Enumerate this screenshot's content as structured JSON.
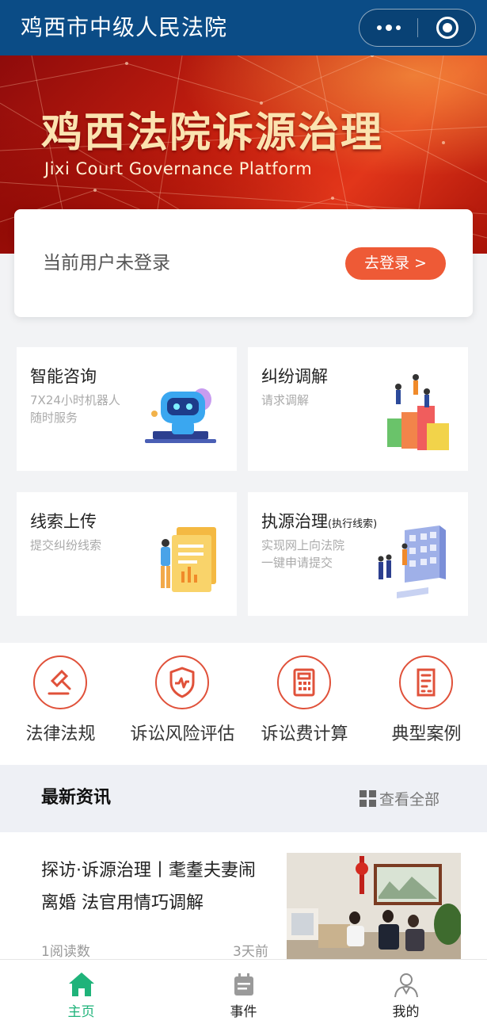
{
  "titlebar": {
    "title": "鸡西市中级人民法院"
  },
  "banner": {
    "title": "鸡西法院诉源治理",
    "subtitle": "Jixi Court Governance Platform"
  },
  "login": {
    "status": "当前用户未登录",
    "button": "去登录 >"
  },
  "services": [
    {
      "title": "智能咨询",
      "title_note": "",
      "desc": "7X24小时机器人\n随时服务",
      "icon": "robot-illustration"
    },
    {
      "title": "纠纷调解",
      "title_note": "",
      "desc": "请求调解",
      "icon": "mediation-illustration"
    },
    {
      "title": "线索上传",
      "title_note": "",
      "desc": "提交纠纷线索",
      "icon": "document-upload-illustration"
    },
    {
      "title": "执源治理",
      "title_note": "(执行线索)",
      "desc": "实现网上向法院\n一键申请提交",
      "icon": "execution-illustration"
    }
  ],
  "tools": [
    {
      "label": "法律法规",
      "icon": "gavel-icon"
    },
    {
      "label": "诉讼风险评估",
      "icon": "shield-pulse-icon"
    },
    {
      "label": "诉讼费计算",
      "icon": "calculator-icon"
    },
    {
      "label": "典型案例",
      "icon": "case-document-icon"
    }
  ],
  "news_section": {
    "title": "最新资讯",
    "more": "查看全部"
  },
  "news": [
    {
      "headline": "探访·诉源治理丨耄耋夫妻闹离婚 法官用情巧调解",
      "reads": "1阅读数",
      "time": "3天前"
    }
  ],
  "tabbar": [
    {
      "label": "主页",
      "icon": "home-icon",
      "active": true
    },
    {
      "label": "事件",
      "icon": "calendar-icon",
      "active": false
    },
    {
      "label": "我的",
      "icon": "user-icon",
      "active": false
    }
  ],
  "colors": {
    "titlebar": "#0b4c86",
    "accent": "#ee5a36",
    "tool_red": "#e0513a",
    "tab_active": "#1fb37a"
  }
}
